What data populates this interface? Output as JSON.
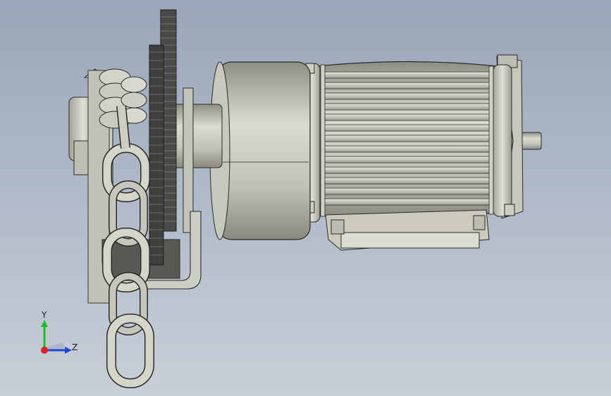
{
  "triad": {
    "y_label": "Y",
    "z_label": "Z",
    "colors": {
      "y": "#1cbf2a",
      "z": "#1f46d8",
      "x": "#e0201c"
    }
  },
  "model": {
    "colors": {
      "metal_light": "#d9d8cc",
      "metal_mid": "#b9b8ab",
      "metal_dark": "#7d7c72",
      "edge": "#2a2a2a",
      "gear": "#555555"
    }
  }
}
